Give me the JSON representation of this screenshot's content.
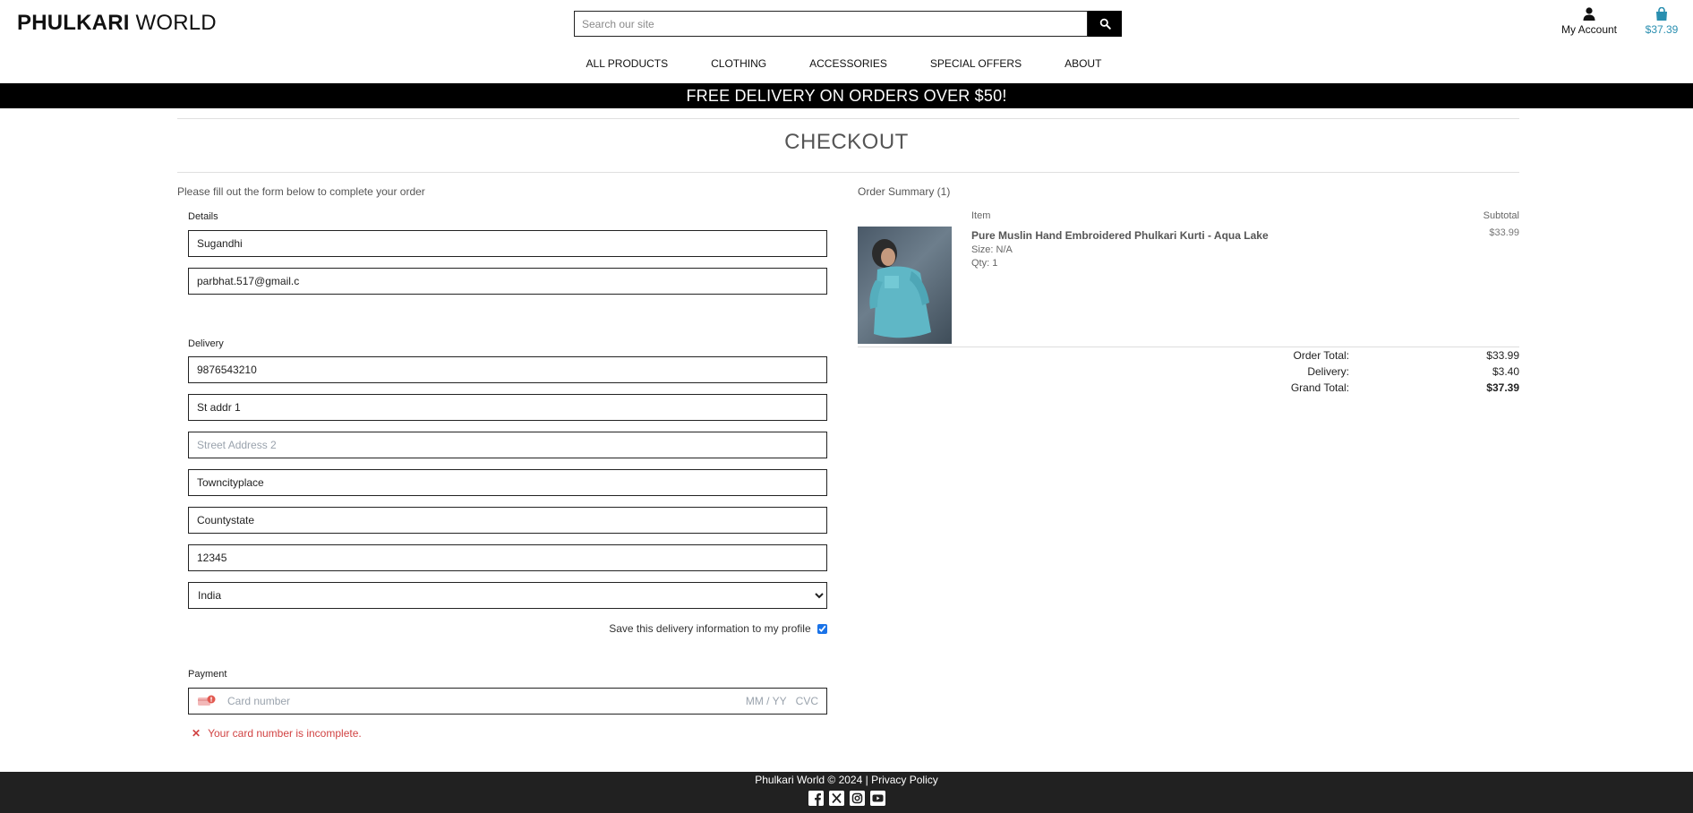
{
  "brand": {
    "name_bold": "PHULKARI",
    "name_rest": "WORLD"
  },
  "search": {
    "placeholder": "Search our site"
  },
  "account": {
    "label": "My Account"
  },
  "cart": {
    "total": "$37.39"
  },
  "nav": [
    "ALL PRODUCTS",
    "CLOTHING",
    "ACCESSORIES",
    "SPECIAL OFFERS",
    "ABOUT"
  ],
  "banner": "FREE DELIVERY ON ORDERS OVER $50!",
  "page_title": "CHECKOUT",
  "form": {
    "intro": "Please fill out the form below to complete your order",
    "details_label": "Details",
    "full_name": "Sugandhi",
    "email": "parbhat.517@gmail.c",
    "delivery_label": "Delivery",
    "phone": "9876543210",
    "street1": "St addr 1",
    "street2_placeholder": "Street Address 2",
    "town": "Towncityplace",
    "county": "Countystate",
    "postcode": "12345",
    "country": "India",
    "save_info_label": "Save this delivery information to my profile",
    "save_info_checked": true,
    "payment_label": "Payment",
    "card_placeholder": "Card number",
    "card_expiry_placeholder": "MM / YY",
    "card_cvc_placeholder": "CVC",
    "card_error": "Your card number is incomplete."
  },
  "summary": {
    "title": "Order Summary (1)",
    "col_item": "Item",
    "col_subtotal": "Subtotal",
    "product_name": "Pure Muslin Hand Embroidered Phulkari Kurti - Aqua Lake",
    "product_size": "Size: N/A",
    "product_qty": "Qty: 1",
    "product_subtotal": "$33.99",
    "order_total_label": "Order Total:",
    "order_total": "$33.99",
    "delivery_label": "Delivery:",
    "delivery": "$3.40",
    "grand_total_label": "Grand Total:",
    "grand_total": "$37.39"
  },
  "footer": {
    "copyright": "Phulkari World © 2024 |",
    "privacy": "Privacy Policy"
  },
  "colors": {
    "accent": "#2a8fb0",
    "error": "#d14343",
    "banner_bg": "#000000",
    "footer_bg": "#212121"
  }
}
